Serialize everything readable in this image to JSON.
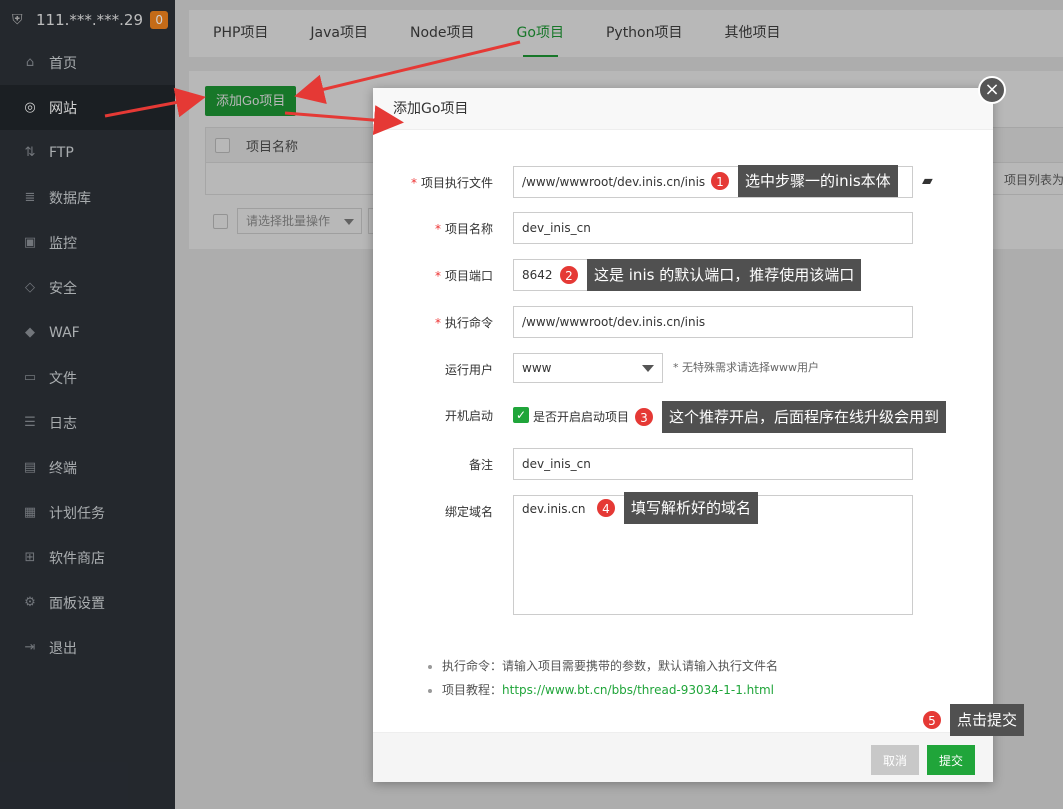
{
  "brand": {
    "ip": "111.***.***.29",
    "badge": "0",
    "icon": "shield-icon"
  },
  "sidebar": {
    "items": [
      {
        "label": "首页",
        "icon": "home-icon"
      },
      {
        "label": "网站",
        "icon": "globe-icon"
      },
      {
        "label": "FTP",
        "icon": "ftp-icon"
      },
      {
        "label": "数据库",
        "icon": "database-icon"
      },
      {
        "label": "监控",
        "icon": "monitor-icon"
      },
      {
        "label": "安全",
        "icon": "shield-check-icon"
      },
      {
        "label": "WAF",
        "icon": "waf-shield-icon"
      },
      {
        "label": "文件",
        "icon": "folder-icon"
      },
      {
        "label": "日志",
        "icon": "log-icon"
      },
      {
        "label": "终端",
        "icon": "terminal-icon"
      },
      {
        "label": "计划任务",
        "icon": "calendar-icon"
      },
      {
        "label": "软件商店",
        "icon": "grid-icon"
      },
      {
        "label": "面板设置",
        "icon": "gear-icon"
      },
      {
        "label": "退出",
        "icon": "logout-icon"
      }
    ]
  },
  "tabs": [
    "PHP项目",
    "Java项目",
    "Node项目",
    "Go项目",
    "Python项目",
    "其他项目"
  ],
  "panel": {
    "add_button": "添加Go项目",
    "col_name": "项目名称",
    "right_text": "项目列表为",
    "batch_placeholder": "请选择批量操作"
  },
  "dialog": {
    "title": "添加Go项目",
    "fields": {
      "exec_file_label": "项目执行文件",
      "exec_file_value": "/www/wwwroot/dev.inis.cn/inis",
      "name_label": "项目名称",
      "name_value": "dev_inis_cn",
      "port_label": "项目端口",
      "port_value": "8642",
      "cmd_label": "执行命令",
      "cmd_value": "/www/wwwroot/dev.inis.cn/inis",
      "user_label": "运行用户",
      "user_value": "www",
      "user_hint": "* 无特殊需求请选择www用户",
      "boot_label": "开机启动",
      "boot_checkbox": "是否开启启动项目",
      "remark_label": "备注",
      "remark_value": "dev_inis_cn",
      "domain_label": "绑定域名",
      "domain_value": "dev.inis.cn"
    },
    "notes": {
      "note1": "执行命令：请输入项目需要携带的参数，默认请输入执行文件名",
      "note2_prefix": "项目教程：",
      "note2_link": "https://www.bt.cn/bbs/thread-93034-1-1.html"
    },
    "cancel": "取消",
    "submit": "提交"
  },
  "annotations": {
    "a1_num": "1",
    "a1_text": "选中步骤一的inis本体",
    "a2_num": "2",
    "a2_text": "这是 inis 的默认端口，推荐使用该端口",
    "a3_num": "3",
    "a3_text": "这个推荐开启，后面程序在线升级会用到",
    "a4_num": "4",
    "a4_text": "填写解析好的域名",
    "a5_num": "5",
    "a5_text": "点击提交"
  },
  "colors": {
    "accent": "#20a53a",
    "sidebar": "#2c3138",
    "annotation": "#e53935"
  }
}
